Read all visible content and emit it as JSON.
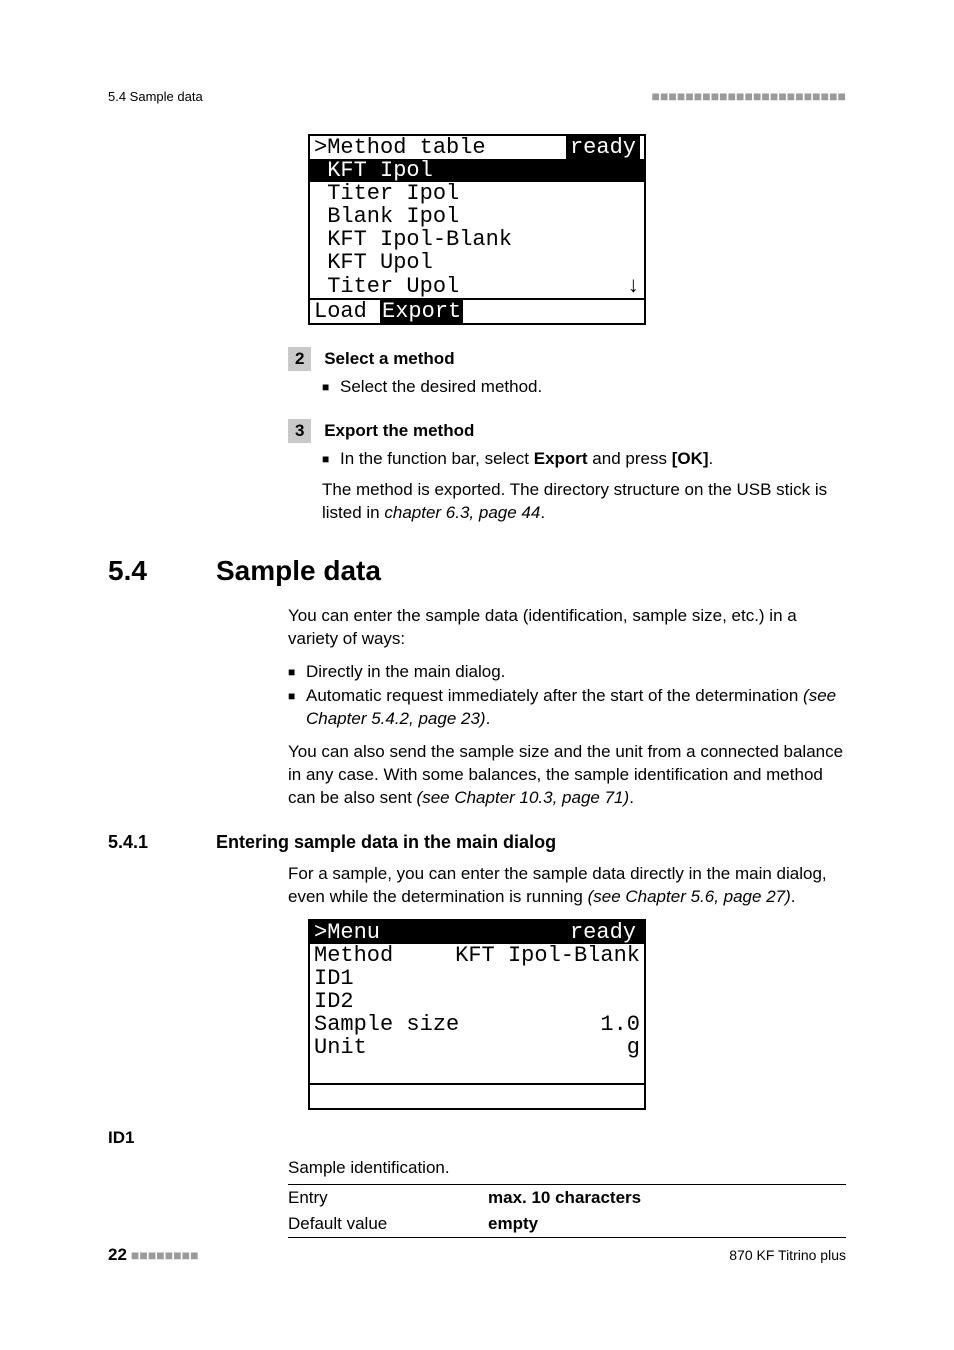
{
  "header": {
    "left": "5.4 Sample data",
    "dashes": "■■■■■■■■■■■■■■■■■■■■■■■"
  },
  "lcd1": {
    "title": ">Method table",
    "status": "ready",
    "selected": " KFT Ipol",
    "items": [
      " Titer Ipol",
      " Blank Ipol",
      " KFT Ipol-Blank",
      " KFT Upol",
      " Titer Upol"
    ],
    "arrow": "↓",
    "footer_left": "Load ",
    "footer_inv": "Export"
  },
  "step2": {
    "num": "2",
    "title": "Select a method",
    "bullet": "Select the desired method."
  },
  "step3": {
    "num": "3",
    "title": "Export the method",
    "bullet_pre": "In the function bar, select ",
    "bullet_b1": "Export",
    "bullet_mid": " and press ",
    "bullet_b2": "[OK]",
    "bullet_post": ".",
    "para1": "The method is exported. The directory structure on the USB stick is listed in ",
    "para1_i": "chapter 6.3, page 44",
    "para1_end": "."
  },
  "sec": {
    "num": "5.4",
    "title": "Sample data",
    "intro": "You can enter the sample data (identification, sample size, etc.) in a variety of ways:",
    "li1": "Directly in the main dialog.",
    "li2_a": "Automatic request immediately after the start of the determination ",
    "li2_i": "(see Chapter 5.4.2, page 23)",
    "li2_b": ".",
    "p2_a": "You can also send the sample size and the unit from a connected balance in any case. With some balances, the sample identification and method can be also sent ",
    "p2_i": "(see Chapter 10.3, page 71)",
    "p2_b": "."
  },
  "sub": {
    "num": "5.4.1",
    "title": "Entering sample data in the main dialog",
    "p_a": "For a sample, you can enter the sample data directly in the main dialog, even while the determination is running ",
    "p_i": "(see Chapter 5.6, page 27)",
    "p_b": "."
  },
  "lcd2": {
    "title": ">Menu",
    "status": "ready",
    "rows": [
      {
        "k": " Method",
        "v": "KFT Ipol-Blank "
      },
      {
        "k": " ID1",
        "v": ""
      },
      {
        "k": " ID2",
        "v": ""
      },
      {
        "k": " Sample size",
        "v": "1.0 "
      },
      {
        "k": " Unit",
        "v": "g "
      }
    ]
  },
  "id1": {
    "label": "ID1",
    "desc": "Sample identification.",
    "rows": [
      {
        "k": "Entry",
        "v": "max. 10 characters"
      },
      {
        "k": "Default value",
        "v": "empty"
      }
    ]
  },
  "footer": {
    "page": "22",
    "dashes": "■■■■■■■■",
    "product": "870 KF Titrino plus"
  }
}
